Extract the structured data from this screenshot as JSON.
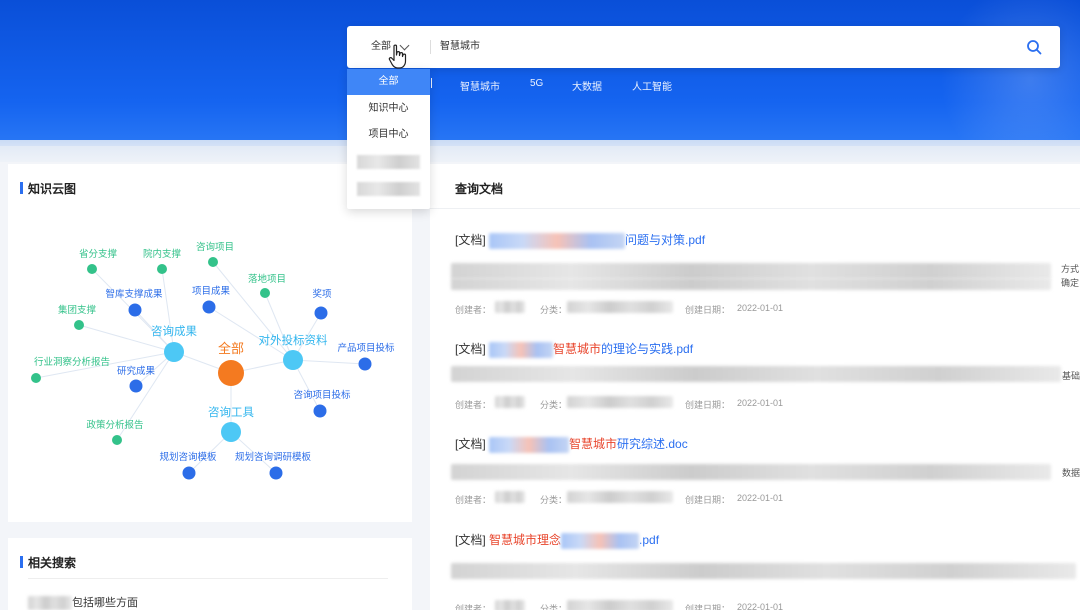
{
  "search": {
    "scope_label": "全部",
    "query": "智慧城市"
  },
  "hot_tags": [
    "智慧城市",
    "5G",
    "大数据",
    "人工智能"
  ],
  "dropdown": {
    "options": [
      "全部",
      "知识中心",
      "项目中心"
    ]
  },
  "knowledge_cloud": {
    "title": "知识云图",
    "center": "全部",
    "groups": [
      "咨询成果",
      "对外投标资料",
      "咨询工具"
    ],
    "leaves": {
      "zixun": [
        "省分支撑",
        "院内支撑",
        "智库支撑成果",
        "集团支撑",
        "研究成果",
        "行业洞察分析报告",
        "政策分析报告"
      ],
      "toubiao": [
        "咨询项目",
        "落地项目",
        "项目成果",
        "奖项",
        "产品项目投标",
        "咨询项目投标"
      ],
      "gongju": [
        "规划咨询模板",
        "规划咨询调研模板"
      ]
    }
  },
  "documents": {
    "title": "查询文档",
    "items": [
      {
        "tag": "[文档]",
        "highlight": "",
        "suffix": "问题与对策.pdf",
        "creator_label": "创建者：",
        "category_label": "分类：",
        "date_label": "创建日期：",
        "date": "2022-01-01"
      },
      {
        "tag": "[文档]",
        "highlight": "智慧城市",
        "suffix": "的理论与实践.pdf",
        "creator_label": "创建者：",
        "category_label": "分类：",
        "date_label": "创建日期：",
        "date": "2022-01-01"
      },
      {
        "tag": "[文档]",
        "highlight": "智慧城市",
        "suffix": "研究综述.doc",
        "creator_label": "创建者：",
        "category_label": "分类：",
        "date_label": "创建日期：",
        "date": "2022-01-01"
      },
      {
        "tag": "[文档]",
        "highlight": "智慧城市理念",
        "suffix": ".pdf",
        "creator_label": "创建者：",
        "category_label": "分类：",
        "date_label": "创建日期：",
        "date": "2022-01-01"
      }
    ],
    "snippet_fragments": [
      "方式",
      "确定",
      "基础",
      "数据"
    ]
  },
  "related": {
    "title": "相关搜索",
    "item_suffix": "包括哪些方面"
  },
  "colors": {
    "primary": "#2b6ff0",
    "highlight": "#e8452c",
    "center_node": "#f47a20",
    "group_node": "#4dc8f5",
    "blue_leaf": "#2c6de8",
    "green_leaf": "#33c28a"
  }
}
